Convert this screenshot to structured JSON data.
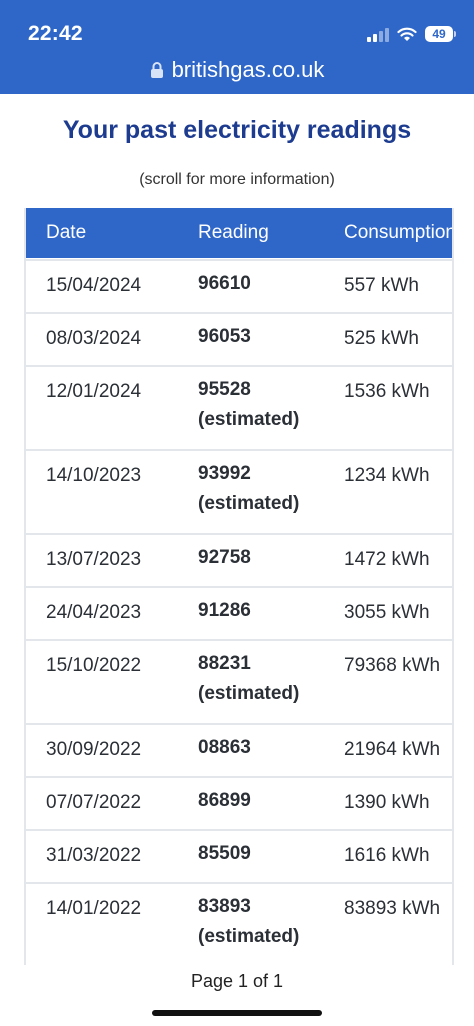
{
  "status_bar": {
    "time": "22:42",
    "battery": "49"
  },
  "browser": {
    "url": "britishgas.co.uk"
  },
  "page": {
    "title": "Your past electricity readings",
    "subtitle": "(scroll for more information)",
    "pager": "Page 1 of 1"
  },
  "table": {
    "headers": {
      "date": "Date",
      "reading": "Reading",
      "consumption": "Consumption"
    },
    "rows": [
      {
        "date": "15/04/2024",
        "reading": "96610",
        "note": "",
        "consumption": "557 kWh"
      },
      {
        "date": "08/03/2024",
        "reading": "96053",
        "note": "",
        "consumption": "525 kWh"
      },
      {
        "date": "12/01/2024",
        "reading": "95528",
        "note": "(estimated)",
        "consumption": "1536 kWh"
      },
      {
        "date": "14/10/2023",
        "reading": "93992",
        "note": "(estimated)",
        "consumption": "1234 kWh"
      },
      {
        "date": "13/07/2023",
        "reading": "92758",
        "note": "",
        "consumption": "1472 kWh"
      },
      {
        "date": "24/04/2023",
        "reading": "91286",
        "note": "",
        "consumption": "3055 kWh"
      },
      {
        "date": "15/10/2022",
        "reading": "88231",
        "note": "(estimated)",
        "consumption": "79368 kWh"
      },
      {
        "date": "30/09/2022",
        "reading": "08863",
        "note": "",
        "consumption": "21964 kWh"
      },
      {
        "date": "07/07/2022",
        "reading": "86899",
        "note": "",
        "consumption": "1390 kWh"
      },
      {
        "date": "31/03/2022",
        "reading": "85509",
        "note": "",
        "consumption": "1616 kWh"
      },
      {
        "date": "14/01/2022",
        "reading": "83893",
        "note": "(estimated)",
        "consumption": "83893 kWh"
      }
    ]
  },
  "colors": {
    "brand_blue": "#2f67c9",
    "title_blue": "#1d3c8f",
    "row_border": "#e3e6ea"
  }
}
